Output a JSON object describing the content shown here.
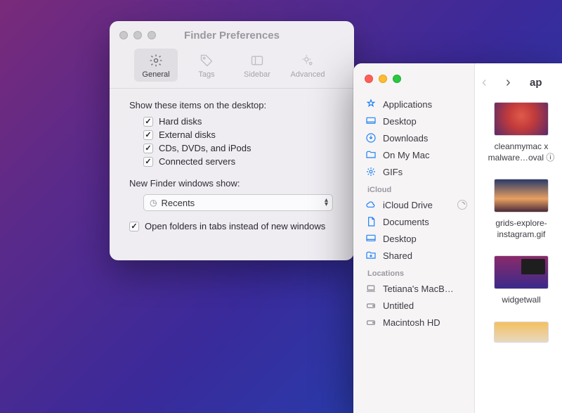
{
  "prefs": {
    "title": "Finder Preferences",
    "tabs": [
      {
        "label": "General"
      },
      {
        "label": "Tags"
      },
      {
        "label": "Sidebar"
      },
      {
        "label": "Advanced"
      }
    ],
    "section1_label": "Show these items on the desktop:",
    "checks": [
      {
        "label": "Hard disks"
      },
      {
        "label": "External disks"
      },
      {
        "label": "CDs, DVDs, and iPods"
      },
      {
        "label": "Connected servers"
      }
    ],
    "section2_label": "New Finder windows show:",
    "popup_value": "Recents",
    "bottom_check": "Open folders in tabs instead of new windows"
  },
  "finder": {
    "path_title": "ap",
    "favorites": [
      {
        "label": "Applications"
      },
      {
        "label": "Desktop"
      },
      {
        "label": "Downloads"
      },
      {
        "label": "On My Mac"
      },
      {
        "label": "GIFs"
      }
    ],
    "icloud_header": "iCloud",
    "icloud": [
      {
        "label": "iCloud Drive"
      },
      {
        "label": "Documents"
      },
      {
        "label": "Desktop"
      },
      {
        "label": "Shared"
      }
    ],
    "locations_header": "Locations",
    "locations": [
      {
        "label": "Tetiana's MacB…"
      },
      {
        "label": "Untitled"
      },
      {
        "label": "Macintosh HD"
      }
    ],
    "files": [
      {
        "name": "cleanmymac x malware…oval ⓘ"
      },
      {
        "name": "grids-explore-instagram.gif"
      },
      {
        "name": "widgetwall"
      }
    ]
  }
}
